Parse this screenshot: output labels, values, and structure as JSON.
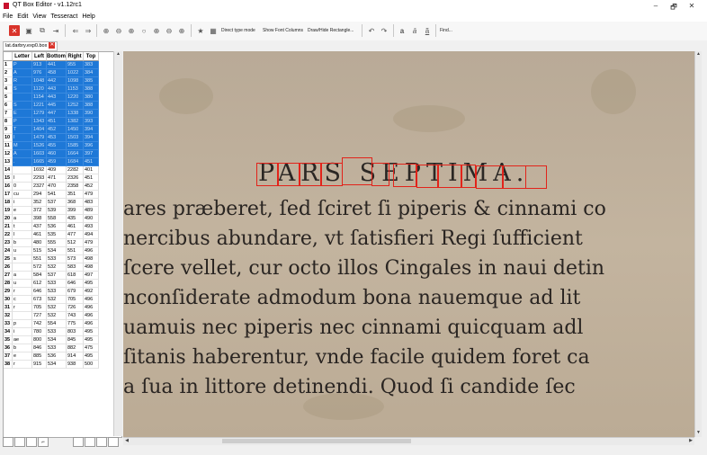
{
  "window": {
    "title": "QT Box Editor - v1.12rc1",
    "min": "–",
    "max": "🗗",
    "close": "✕"
  },
  "menu": [
    "File",
    "Edit",
    "View",
    "Tesseract",
    "Help"
  ],
  "toolbar": {
    "direct_type_mode": "Direct type mode",
    "show_font_columns": "Show Font Columns",
    "draw_hide_rect": "Draw/Hide Rectangle...",
    "find": "Find...",
    "char_a1": "a",
    "char_a2": "ā",
    "char_a3": "ã"
  },
  "file_tab": {
    "label": "lat.darbry.exp0.box"
  },
  "grid": {
    "headers": [
      "",
      "Letter",
      "Left",
      "Bottom",
      "Right",
      "Top"
    ],
    "rows": [
      {
        "n": "1",
        "l": "P",
        "left": "913",
        "bottom": "441",
        "right": "955",
        "top": "383",
        "sel": true
      },
      {
        "n": "2",
        "l": "A",
        "left": "976",
        "bottom": "458",
        "right": "1022",
        "top": "384",
        "sel": true
      },
      {
        "n": "3",
        "l": "R",
        "left": "1048",
        "bottom": "442",
        "right": "1098",
        "top": "385",
        "sel": true
      },
      {
        "n": "4",
        "l": "S",
        "left": "1120",
        "bottom": "443",
        "right": "1153",
        "top": "388",
        "sel": true
      },
      {
        "n": "5",
        "l": "",
        "left": "1154",
        "bottom": "443",
        "right": "1220",
        "top": "380",
        "sel": true
      },
      {
        "n": "6",
        "l": "S",
        "left": "1221",
        "bottom": "445",
        "right": "1252",
        "top": "388",
        "sel": true
      },
      {
        "n": "7",
        "l": "E",
        "left": "1279",
        "bottom": "447",
        "right": "1338",
        "top": "390",
        "sel": true
      },
      {
        "n": "8",
        "l": "P",
        "left": "1343",
        "bottom": "451",
        "right": "1382",
        "top": "393",
        "sel": true
      },
      {
        "n": "9",
        "l": "T",
        "left": "1404",
        "bottom": "452",
        "right": "1450",
        "top": "394",
        "sel": true
      },
      {
        "n": "10",
        "l": "I",
        "left": "1479",
        "bottom": "453",
        "right": "1503",
        "top": "394",
        "sel": true
      },
      {
        "n": "11",
        "l": "M",
        "left": "1526",
        "bottom": "455",
        "right": "1585",
        "top": "396",
        "sel": true
      },
      {
        "n": "12",
        "l": "A",
        "left": "1603",
        "bottom": "460",
        "right": "1664",
        "top": "397",
        "sel": true
      },
      {
        "n": "13",
        "l": ".",
        "left": "1665",
        "bottom": "459",
        "right": "1684",
        "top": "451",
        "sel": true
      },
      {
        "n": "14",
        "l": "",
        "left": "1692",
        "bottom": "409",
        "right": "2282",
        "top": "401",
        "sel": false
      },
      {
        "n": "15",
        "l": "l",
        "left": "2293",
        "bottom": "471",
        "right": "2326",
        "top": "451",
        "sel": false
      },
      {
        "n": "16",
        "l": "0",
        "left": "2327",
        "bottom": "470",
        "right": "2358",
        "top": "452",
        "sel": false
      },
      {
        "n": "17",
        "l": "cu",
        "left": "294",
        "bottom": "541",
        "right": "351",
        "top": "479",
        "sel": false
      },
      {
        "n": "18",
        "l": "i",
        "left": "352",
        "bottom": "537",
        "right": "368",
        "top": "483",
        "sel": false
      },
      {
        "n": "19",
        "l": "e",
        "left": "372",
        "bottom": "539",
        "right": "399",
        "top": "489",
        "sel": false
      },
      {
        "n": "20",
        "l": "a",
        "left": "398",
        "bottom": "558",
        "right": "435",
        "top": "490",
        "sel": false
      },
      {
        "n": "21",
        "l": "t",
        "left": "437",
        "bottom": "536",
        "right": "461",
        "top": "493",
        "sel": false
      },
      {
        "n": "22",
        "l": "l",
        "left": "461",
        "bottom": "535",
        "right": "477",
        "top": "494",
        "sel": false
      },
      {
        "n": "23",
        "l": "b",
        "left": "480",
        "bottom": "555",
        "right": "512",
        "top": "479",
        "sel": false
      },
      {
        "n": "24",
        "l": "u",
        "left": "515",
        "bottom": "534",
        "right": "551",
        "top": "496",
        "sel": false
      },
      {
        "n": "25",
        "l": "s",
        "left": "551",
        "bottom": "533",
        "right": "573",
        "top": "498",
        "sel": false
      },
      {
        "n": "26",
        "l": "",
        "left": "572",
        "bottom": "532",
        "right": "583",
        "top": "498",
        "sel": false
      },
      {
        "n": "27",
        "l": "a",
        "left": "584",
        "bottom": "537",
        "right": "618",
        "top": "497",
        "sel": false
      },
      {
        "n": "28",
        "l": "u",
        "left": "612",
        "bottom": "533",
        "right": "646",
        "top": "495",
        "sel": false
      },
      {
        "n": "29",
        "l": "r",
        "left": "646",
        "bottom": "533",
        "right": "679",
        "top": "492",
        "sel": false
      },
      {
        "n": "30",
        "l": "c",
        "left": "673",
        "bottom": "532",
        "right": "705",
        "top": "496",
        "sel": false
      },
      {
        "n": "31",
        "l": "r",
        "left": "705",
        "bottom": "532",
        "right": "726",
        "top": "496",
        "sel": false
      },
      {
        "n": "32",
        "l": "",
        "left": "727",
        "bottom": "532",
        "right": "743",
        "top": "496",
        "sel": false
      },
      {
        "n": "33",
        "l": "p",
        "left": "742",
        "bottom": "554",
        "right": "775",
        "top": "496",
        "sel": false
      },
      {
        "n": "34",
        "l": "i",
        "left": "780",
        "bottom": "533",
        "right": "803",
        "top": "495",
        "sel": false
      },
      {
        "n": "35",
        "l": "ae",
        "left": "800",
        "bottom": "534",
        "right": "845",
        "top": "495",
        "sel": false
      },
      {
        "n": "36",
        "l": "b",
        "left": "846",
        "bottom": "533",
        "right": "882",
        "top": "475",
        "sel": false
      },
      {
        "n": "37",
        "l": "e",
        "left": "885",
        "bottom": "536",
        "right": "914",
        "top": "495",
        "sel": false
      },
      {
        "n": "38",
        "l": "r",
        "left": "915",
        "bottom": "534",
        "right": "938",
        "top": "500",
        "sel": false
      }
    ]
  },
  "document": {
    "heading": "PARS SEPTIMA.",
    "lines": [
      "ares præberet, ſed ſciret ſi piperis & cinnami co",
      "nercibus abundare, vt ſatisfieri Regi ſufficient",
      "ſcere vellet, cur octo illos Cingales in naui detin",
      "nconſiderate admodum bona nauemque ad lit",
      "uamuis nec piperis nec cinnami quicquam adl",
      "ſitanis haberentur, vnde facile quidem foret ca",
      "a ſua in littore detinendi. Quod ſi candide ſec"
    ]
  }
}
